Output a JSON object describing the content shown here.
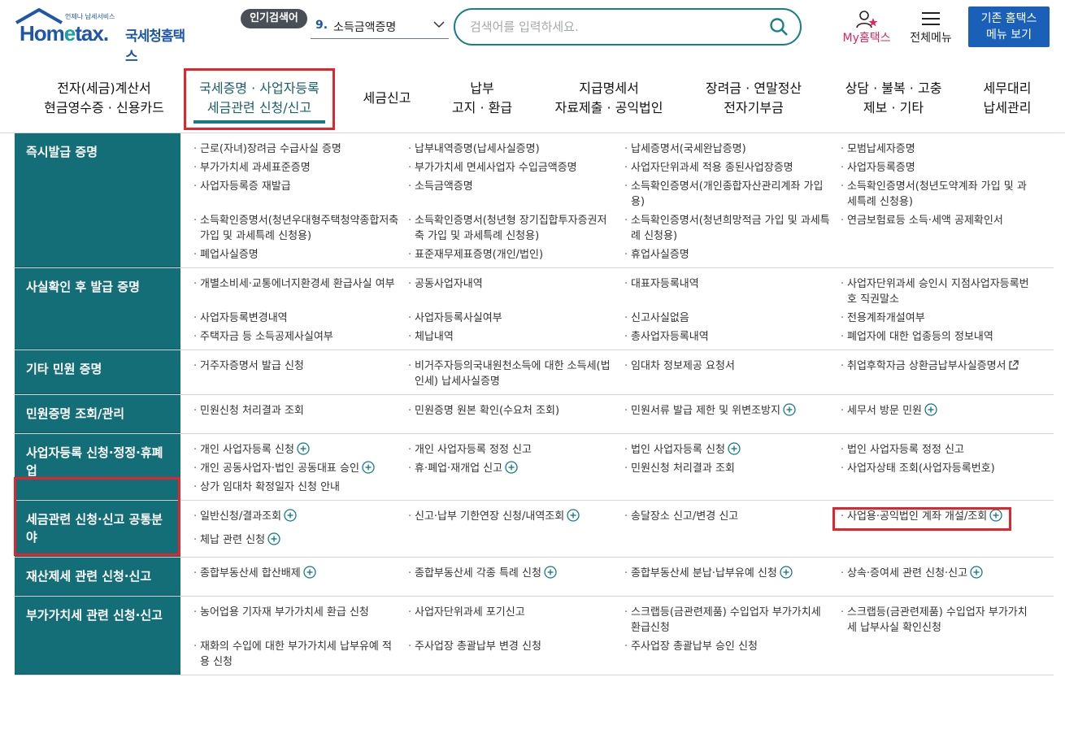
{
  "header": {
    "logo_small": "언제나 납세서비스",
    "logo_brand_a": "Hom",
    "logo_brand_e": "e",
    "logo_brand_b": "tax.",
    "logo_kr": "국세청홈택스",
    "popular_badge": "인기검색어",
    "popular_num": "9.",
    "popular_term": "소득금액증명",
    "search_placeholder": "검색어를 입력하세요.",
    "my_hometax": "My홈택스",
    "all_menu": "전체메뉴",
    "old_menu_line1": "기존 홈택스",
    "old_menu_line2": "메뉴 보기"
  },
  "nav": [
    {
      "label": "전자(세금)계산서\n현금영수증 · 신용카드"
    },
    {
      "label": "국세증명 · 사업자등록\n세금관련 신청/신고",
      "active": true
    },
    {
      "label": "세금신고"
    },
    {
      "label": "납부\n고지 · 환급"
    },
    {
      "label": "지급명세서\n자료제출 · 공익법인"
    },
    {
      "label": "장려금 · 연말정산\n전자기부금"
    },
    {
      "label": "상담 · 불복 · 고충\n제보 · 기타"
    },
    {
      "label": "세무대리\n납세관리"
    }
  ],
  "sections": [
    {
      "title": "즉시발급 증명",
      "items": [
        {
          "t": "근로(자녀)장려금 수급사실 증명"
        },
        {
          "t": "납부내역증명(납세사실증명)"
        },
        {
          "t": "납세증명서(국세완납증명)"
        },
        {
          "t": "모범납세자증명"
        },
        {
          "t": "부가가치세 과세표준증명"
        },
        {
          "t": "부가가치세 면세사업자 수입금액증명"
        },
        {
          "t": "사업자단위과세 적용 종된사업장증명"
        },
        {
          "t": "사업자등록증명"
        },
        {
          "t": "사업자등록증 재발급"
        },
        {
          "t": "소득금액증명"
        },
        {
          "t": "소득확인증명서(개인종합자산관리계좌 가입용)"
        },
        {
          "t": "소득확인증명서(청년도약계좌 가입 및 과세특례 신청용)"
        },
        {
          "t": "소득확인증명서(청년우대형주택청약종합저축 가입 및 과세특례 신청용)"
        },
        {
          "t": "소득확인증명서(청년형 장기집합투자증권저축 가입 및 과세특례 신청용)"
        },
        {
          "t": "소득확인증명서(청년희망적금 가입 및 과세특례 신청용)"
        },
        {
          "t": "연금보험료등 소득·세액 공제확인서"
        },
        {
          "t": "폐업사실증명"
        },
        {
          "t": "표준재무제표증명(개인/법인)"
        },
        {
          "t": "휴업사실증명"
        }
      ]
    },
    {
      "title": "사실확인 후 발급 증명",
      "items": [
        {
          "t": "개별소비세·교통에너지환경세 환급사실 여부"
        },
        {
          "t": "공동사업자내역"
        },
        {
          "t": "대표자등록내역"
        },
        {
          "t": "사업자단위과세 승인시 지점사업자등록번호 직권말소"
        },
        {
          "t": "사업자등록변경내역"
        },
        {
          "t": "사업자등록사실여부"
        },
        {
          "t": "신고사실없음"
        },
        {
          "t": "전용계좌개설여부"
        },
        {
          "t": "주택자금 등 소득공제사실여부"
        },
        {
          "t": "체납내역"
        },
        {
          "t": "총사업자등록내역"
        },
        {
          "t": "폐업자에 대한 업종등의 정보내역"
        }
      ]
    },
    {
      "title": "기타 민원 증명",
      "items": [
        {
          "t": "거주자증명서 발급 신청"
        },
        {
          "t": "비거주자등의국내원천소득에 대한 소득세(법인세) 납세사실증명"
        },
        {
          "t": "임대차 정보제공 요청서"
        },
        {
          "t": "취업후학자금 상환금납부사실증명서",
          "ext": true
        }
      ]
    },
    {
      "title": "민원증명 조회/관리",
      "items": [
        {
          "t": "민원신청 처리결과 조회"
        },
        {
          "t": "민원증명 원본 확인(수요처 조회)"
        },
        {
          "t": "민원서류 발급 제한 및 위변조방지",
          "plus": true
        },
        {
          "t": "세무서 방문 민원",
          "plus": true
        }
      ]
    },
    {
      "title": "사업자등록 신청·정정·휴폐업",
      "items": [
        {
          "t": "개인 사업자등록 신청",
          "plus": true
        },
        {
          "t": "개인 사업자등록 정정 신고"
        },
        {
          "t": "법인 사업자등록 신청",
          "plus": true
        },
        {
          "t": "법인 사업자등록 정정 신고"
        },
        {
          "t": "개인 공동사업자·법인 공동대표 승인",
          "plus": true
        },
        {
          "t": "휴·폐업·재개업 신고",
          "plus": true
        },
        {
          "t": "민원신청 처리결과 조회"
        },
        {
          "t": "사업자상태 조회(사업자등록번호)"
        },
        {
          "t": "상가 임대차 확정일자 신청 안내"
        }
      ]
    },
    {
      "title": "세금관련 신청·신고 공통분야",
      "items": [
        {
          "t": "일반신청/결과조회",
          "plus": true
        },
        {
          "t": "신고·납부 기한연장 신청/내역조회",
          "plus": true
        },
        {
          "t": "송달장소 신고/변경 신고"
        },
        {
          "t": "사업용·공익법인 계좌 개설/조회",
          "plus": true
        },
        {
          "t": "체납 관련 신청",
          "plus": true
        }
      ]
    },
    {
      "title": "재산제세 관련 신청·신고",
      "items": [
        {
          "t": "종합부동산세 합산배제",
          "plus": true
        },
        {
          "t": "종합부동산세 각종 특례 신청",
          "plus": true
        },
        {
          "t": "종합부동산세 분납·납부유예 신청",
          "plus": true
        },
        {
          "t": "상속·증여세 관련 신청·신고",
          "plus": true
        }
      ]
    },
    {
      "title": "부가가치세 관련 신청·신고",
      "items": [
        {
          "t": "농어업용 기자재 부가가치세 환급 신청"
        },
        {
          "t": "사업자단위과세 포기신고"
        },
        {
          "t": "스크랩등(금관련제품) 수입업자 부가가치세 환급신청"
        },
        {
          "t": "스크랩등(금관련제품) 수입업자 부가가치세 납부사실 확인신청"
        },
        {
          "t": "재화의 수입에 대한 부가가치세 납부유예 적용 신청"
        },
        {
          "t": "주사업장 총괄납부 변경 신청"
        },
        {
          "t": "주사업장 총괄납부 승인 신청"
        }
      ]
    }
  ]
}
